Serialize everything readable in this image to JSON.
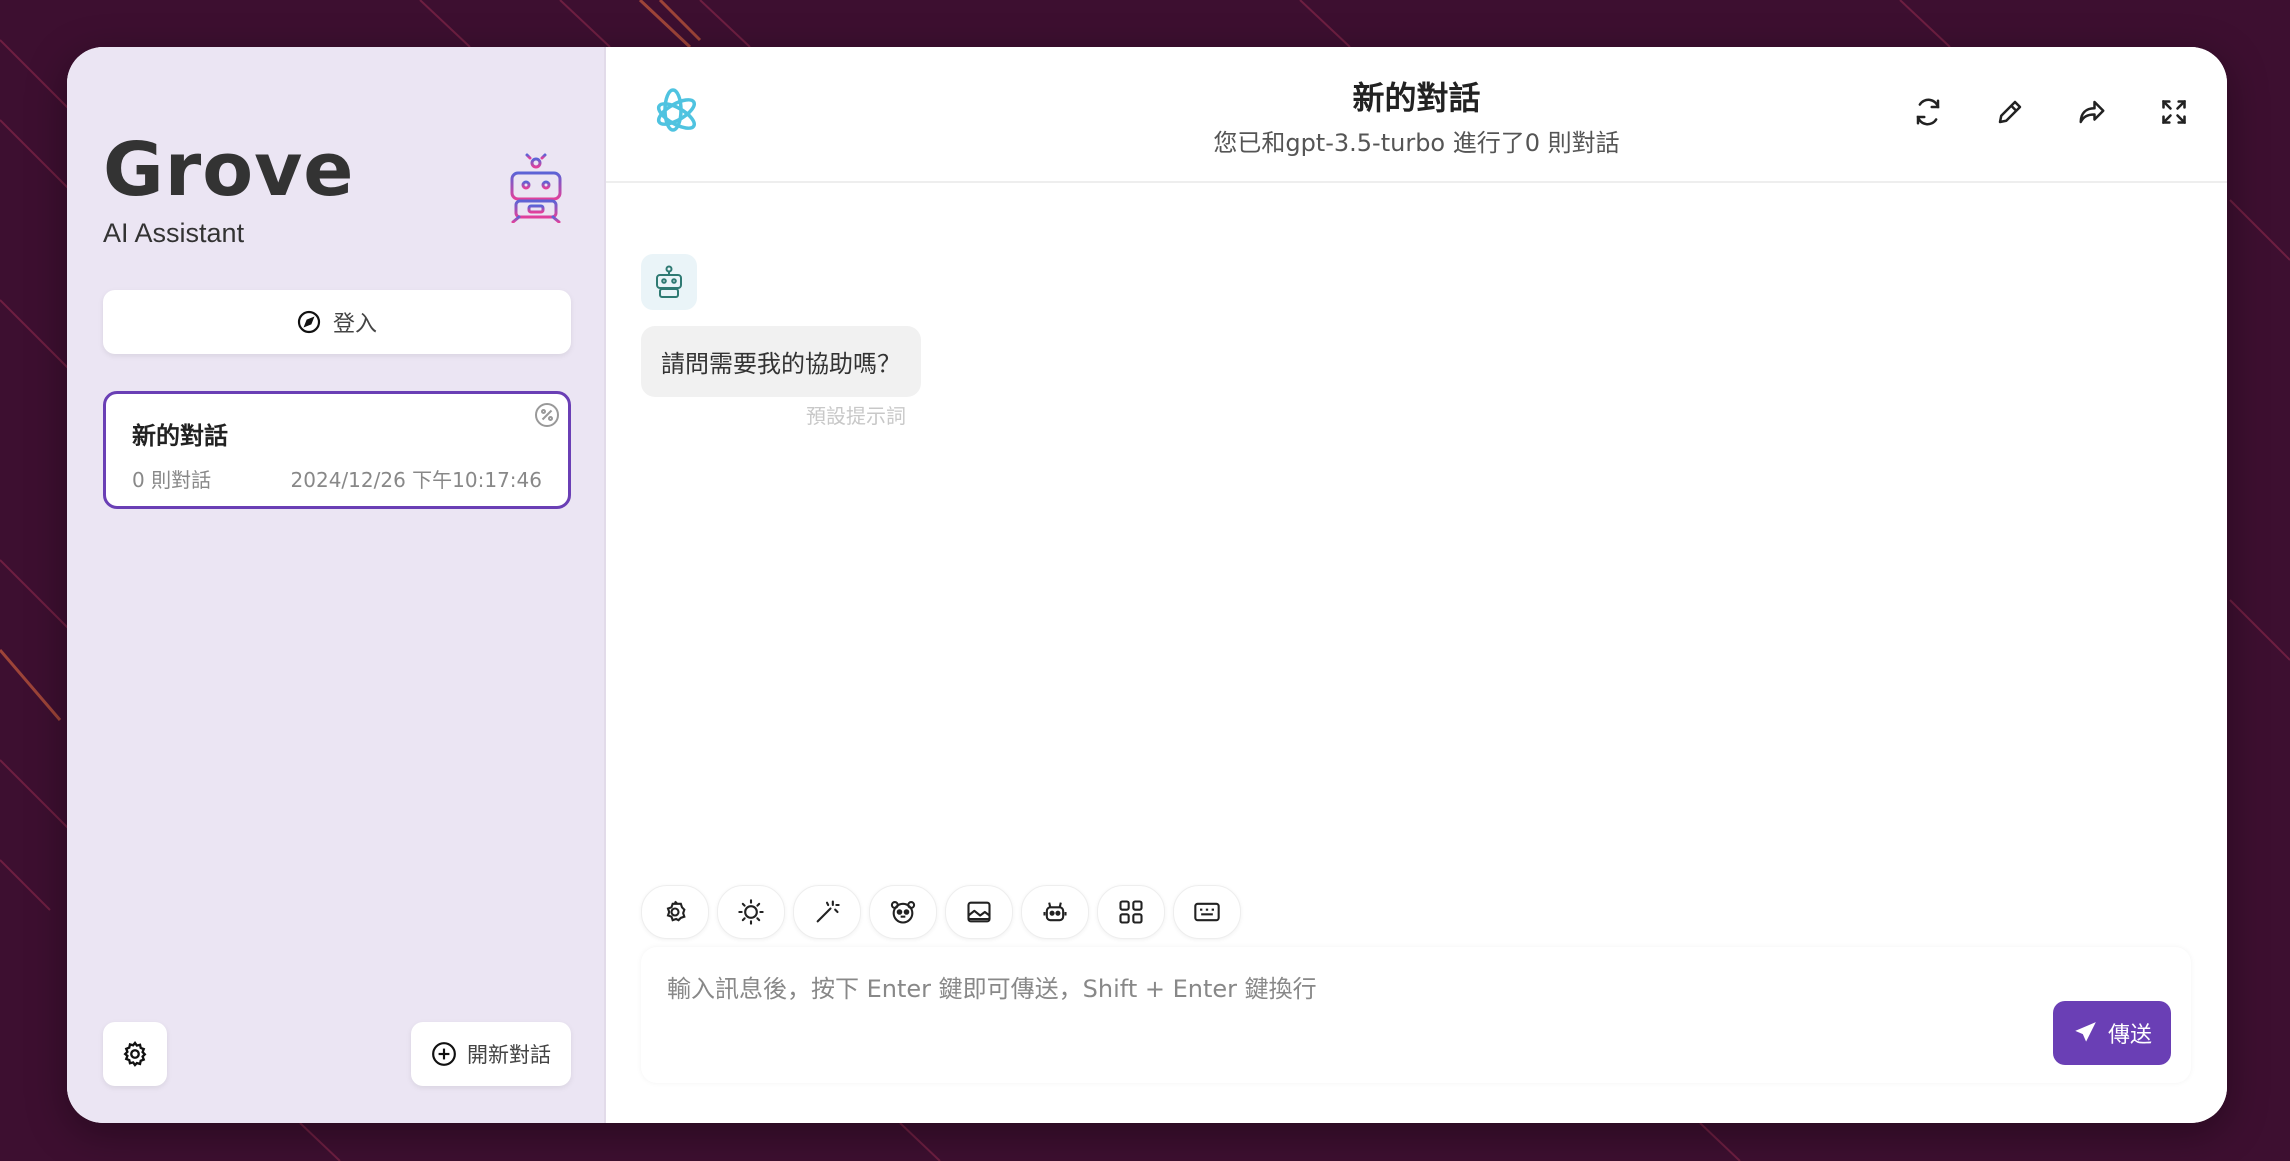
{
  "sidebar": {
    "brand_title": "Grove",
    "brand_subtitle": "AI Assistant",
    "login_label": "登入",
    "conversations": [
      {
        "title": "新的對話",
        "count": "0 則對話",
        "time": "2024/12/26 下午10:17:46"
      }
    ],
    "new_chat_label": "開新對話"
  },
  "header": {
    "title": "新的對話",
    "subtitle": "您已和gpt-3.5-turbo 進行了0 則對話"
  },
  "messages": [
    {
      "role": "bot",
      "text": "請問需要我的協助嗎？",
      "hint": "預設提示詞"
    }
  ],
  "input": {
    "placeholder": "輸入訊息後，按下 Enter 鍵即可傳送，Shift + Enter 鍵換行",
    "value": "",
    "send_label": "傳送"
  },
  "toolbar_icons": [
    "settings-icon",
    "theme-icon",
    "magic-wand-icon",
    "mask-icon",
    "image-icon",
    "robot-icon",
    "apps-icon",
    "keyboard-icon"
  ],
  "colors": {
    "accent": "#6a3fb5",
    "background": "#3d0f30",
    "sidebar": "#ebe5f3"
  }
}
